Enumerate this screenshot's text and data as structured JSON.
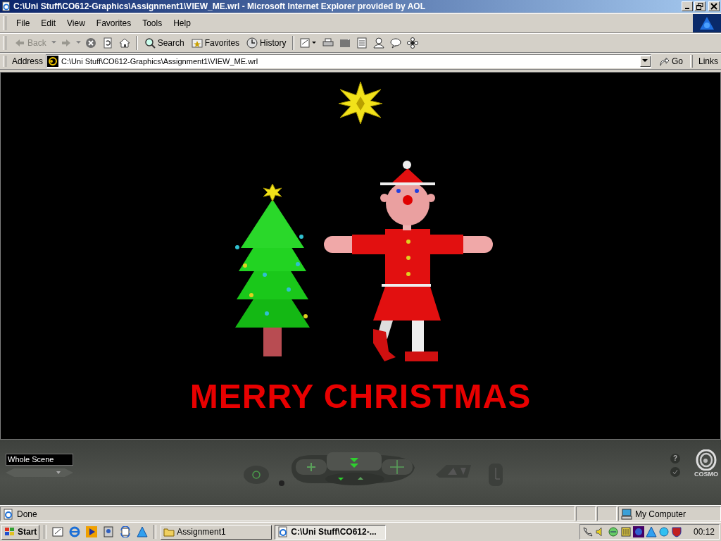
{
  "window": {
    "title": "C:\\Uni Stuff\\CO612-Graphics\\Assignment1\\VIEW_ME.wrl - Microsoft Internet Explorer provided by AOL"
  },
  "menu": [
    "File",
    "Edit",
    "View",
    "Favorites",
    "Tools",
    "Help"
  ],
  "toolbar": {
    "buttons": [
      {
        "label": "Back",
        "disabled": true
      },
      {
        "label": "Search",
        "disabled": false
      },
      {
        "label": "Favorites",
        "disabled": false
      },
      {
        "label": "History",
        "disabled": false
      }
    ]
  },
  "address": {
    "label": "Address",
    "value": "C:\\Uni Stuff\\CO612-Graphics\\Assignment1\\VIEW_ME.wrl",
    "go": "Go",
    "links": "Links"
  },
  "scene": {
    "caption": "MERRY CHRISTMAS"
  },
  "cosmo": {
    "viewpoint": "Whole Scene",
    "help": "?",
    "logo": "COSMO"
  },
  "status_bar": {
    "text": "Done",
    "zone": "My Computer"
  },
  "taskbar": {
    "start": "Start",
    "tasks": [
      {
        "label": "Assignment1",
        "selected": false
      },
      {
        "label": "C:\\Uni Stuff\\CO612-...",
        "selected": true
      }
    ],
    "clock": "00:12"
  }
}
